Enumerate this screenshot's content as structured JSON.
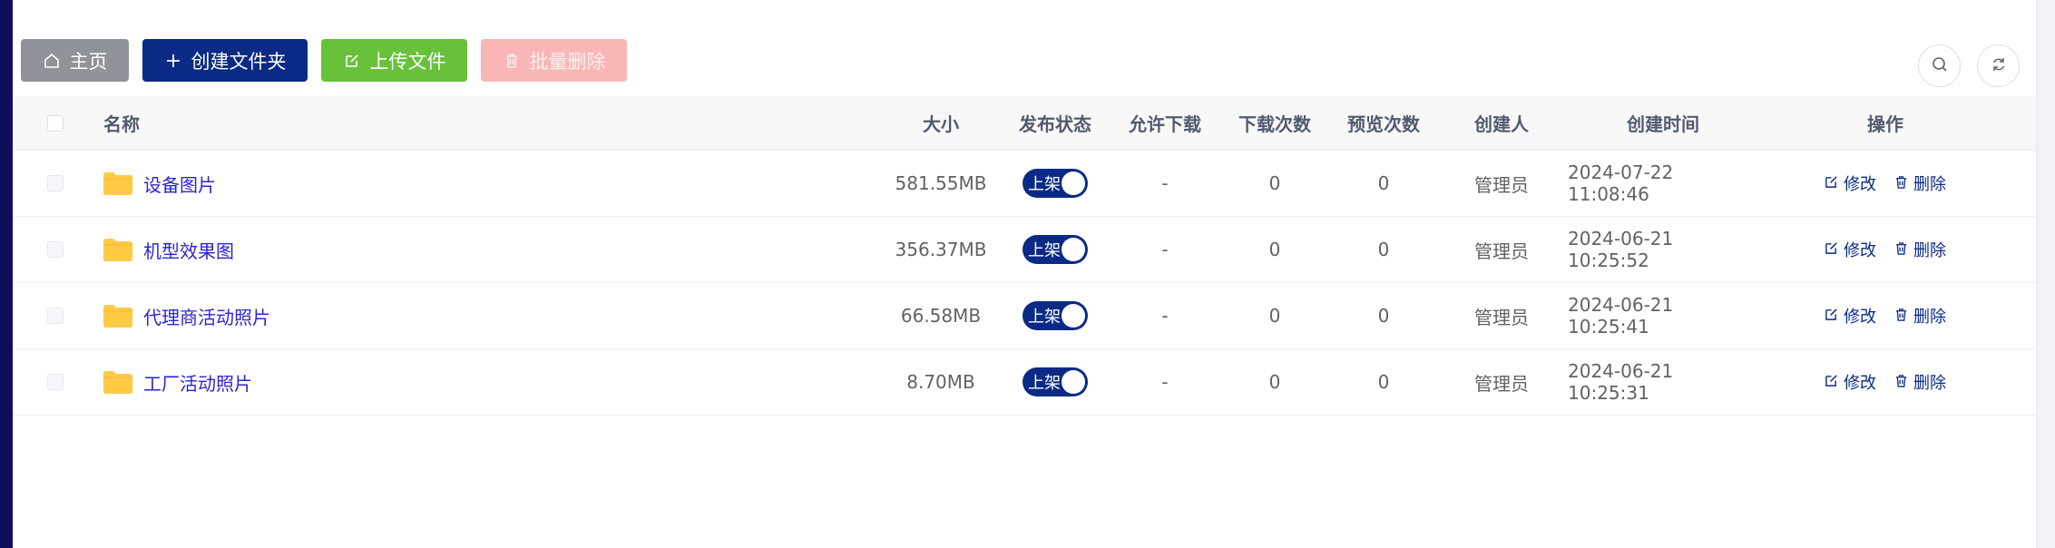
{
  "toolbar": {
    "home_label": "主页",
    "create_folder_label": "创建文件夹",
    "upload_label": "上传文件",
    "batch_delete_label": "批量删除"
  },
  "table": {
    "headers": {
      "name": "名称",
      "size": "大小",
      "status": "发布状态",
      "allow_download": "允许下载",
      "downloads": "下载次数",
      "previews": "预览次数",
      "creator": "创建人",
      "created_at": "创建时间",
      "actions": "操作"
    },
    "rows": [
      {
        "name": "设备图片",
        "size": "581.55MB",
        "status": "上架",
        "allow_download": "-",
        "downloads": "0",
        "previews": "0",
        "creator": "管理员",
        "created_at": "2024-07-22 11:08:46",
        "edit": "修改",
        "delete": "删除"
      },
      {
        "name": "机型效果图",
        "size": "356.37MB",
        "status": "上架",
        "allow_download": "-",
        "downloads": "0",
        "previews": "0",
        "creator": "管理员",
        "created_at": "2024-06-21 10:25:52",
        "edit": "修改",
        "delete": "删除"
      },
      {
        "name": "代理商活动照片",
        "size": "66.58MB",
        "status": "上架",
        "allow_download": "-",
        "downloads": "0",
        "previews": "0",
        "creator": "管理员",
        "created_at": "2024-06-21 10:25:41",
        "edit": "修改",
        "delete": "删除"
      },
      {
        "name": "工厂活动照片",
        "size": "8.70MB",
        "status": "上架",
        "allow_download": "-",
        "downloads": "0",
        "previews": "0",
        "creator": "管理员",
        "created_at": "2024-06-21 10:25:31",
        "edit": "修改",
        "delete": "删除"
      }
    ]
  },
  "icons": {
    "home": "home-icon",
    "plus": "plus-icon",
    "upload": "edit-icon",
    "trash": "trash-icon",
    "search": "search-icon",
    "refresh": "refresh-icon",
    "folder": "folder-icon"
  },
  "colors": {
    "primary": "#0a2a86",
    "success": "#67c23a",
    "danger_disabled": "#fab6b6",
    "info": "#909399",
    "folder": "#ffcb47"
  }
}
